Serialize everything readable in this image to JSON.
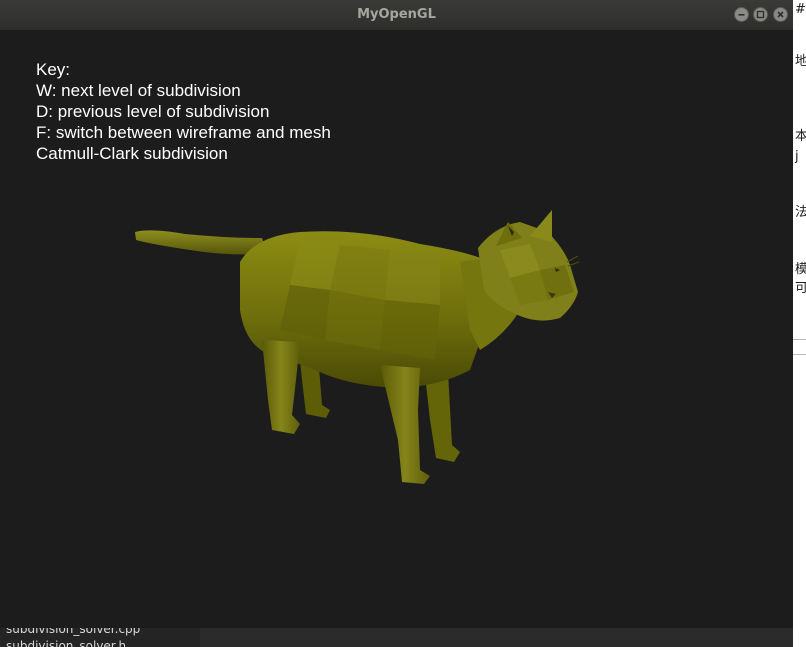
{
  "window": {
    "title": "MyOpenGL",
    "buttons": {
      "minimize_icon": "minimize-icon",
      "maximize_icon": "maximize-icon",
      "close_icon": "close-icon"
    }
  },
  "overlay": {
    "lines": [
      "Key:",
      "W: next level of subdivision",
      "D: previous level of subdivision",
      "F: switch between wireframe and mesh",
      "Catmull-Clark subdivision"
    ]
  },
  "model": {
    "kind": "3d-cat-mesh",
    "color": "#7a7a10"
  },
  "background": {
    "right_glyphs": [
      "#",
      "地",
      "本",
      "j",
      "法",
      "模",
      "可"
    ],
    "bottom_files": [
      "subdivision_solver.cpp",
      "subdivision_solver.h"
    ]
  }
}
